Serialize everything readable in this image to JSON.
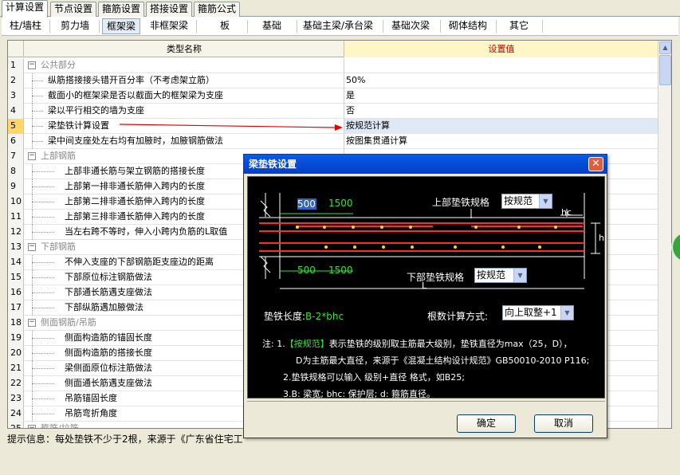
{
  "top_tabs": [
    "计算设置",
    "节点设置",
    "箍筋设置",
    "搭接设置",
    "箍筋公式"
  ],
  "sub_tabs": [
    "柱/墙柱",
    "剪力墙",
    "框架梁",
    "非框架梁",
    "板",
    "基础",
    "基础主梁/承台梁",
    "基础次梁",
    "砌体结构",
    "其它"
  ],
  "grid": {
    "col_name": "类型名称",
    "col_value": "设置值",
    "rows": [
      {
        "num": "1",
        "name": "公共部分",
        "value": ""
      },
      {
        "num": "2",
        "name": "纵筋搭接接头错开百分率（不考虑架立筋）",
        "value": "50%"
      },
      {
        "num": "3",
        "name": "截面小的框架梁是否以截面大的框架梁为支座",
        "value": "是"
      },
      {
        "num": "4",
        "name": "梁以平行相交的墙为支座",
        "value": "否"
      },
      {
        "num": "5",
        "name": "梁垫铁计算设置",
        "value": "按规范计算"
      },
      {
        "num": "6",
        "name": "梁中间支座处左右均有加腋时，加腋钢筋做法",
        "value": "按图集贯通计算"
      },
      {
        "num": "7",
        "name": "上部钢筋",
        "value": ""
      },
      {
        "num": "8",
        "name": "上部非通长筋与架立钢筋的搭接长度",
        "value": ""
      },
      {
        "num": "9",
        "name": "上部第一排非通长筋伸入跨内的长度",
        "value": ""
      },
      {
        "num": "10",
        "name": "上部第二排非通长筋伸入跨内的长度",
        "value": ""
      },
      {
        "num": "11",
        "name": "上部第三排非通长筋伸入跨内的长度",
        "value": ""
      },
      {
        "num": "12",
        "name": "当左右跨不等时，伸入小跨内负筋的L取值",
        "value": ""
      },
      {
        "num": "13",
        "name": "下部钢筋",
        "value": ""
      },
      {
        "num": "14",
        "name": "不伸入支座的下部钢筋距支座边的距离",
        "value": ""
      },
      {
        "num": "15",
        "name": "下部原位标注钢筋做法",
        "value": ""
      },
      {
        "num": "16",
        "name": "下部通长筋遇支座做法",
        "value": ""
      },
      {
        "num": "17",
        "name": "下部纵筋遇加腋做法",
        "value": ""
      },
      {
        "num": "18",
        "name": "侧面钢筋/吊筋",
        "value": ""
      },
      {
        "num": "19",
        "name": "侧面构造筋的锚固长度",
        "value": ""
      },
      {
        "num": "20",
        "name": "侧面构造筋的搭接长度",
        "value": ""
      },
      {
        "num": "21",
        "name": "梁侧面原位标注筋做法",
        "value": ""
      },
      {
        "num": "22",
        "name": "侧面通长筋遇支座做法",
        "value": ""
      },
      {
        "num": "23",
        "name": "吊筋锚固长度",
        "value": ""
      },
      {
        "num": "24",
        "name": "吊筋弯折角度",
        "value": ""
      },
      {
        "num": "25",
        "name": "箍筋/拉筋",
        "value": ""
      }
    ]
  },
  "hint": "提示信息：每处垫铁不少于2根，来源于《广东省住宅工",
  "dialog": {
    "title": "梁垫铁设置",
    "close": "✕",
    "top_spec_label": "上部垫铁规格",
    "top_spec_value": "按规范",
    "bottom_spec_label": "下部垫铁规格",
    "bottom_spec_value": "按规范",
    "dim_500_top": "500",
    "dim_1500_top": "1500",
    "dim_500_bottom": "500",
    "dim_1500_bottom": "1500",
    "dim_hc": "hc",
    "dim_L": "L",
    "dim_h": "h",
    "length_label": "垫铁长度:",
    "length_formula": "B-2*bhc",
    "count_label": "根数计算方式:",
    "count_value": "向上取整+1",
    "note1_prefix": "注: 1.",
    "note1_hl": "【按规范】",
    "note1_rest": "表示垫铁的级别取主筋最大级别，垫铁直径为max（25，D），",
    "note1b": "D为主筋最大直径，来源于《混凝土结构设计规范》GB50010-2010 P116;",
    "note2": "2.垫铁规格可以输入 级别+直径 格式，如B25;",
    "note3": "3.B: 梁宽; bhc: 保护层; d: 箍筋直径。",
    "ok": "确定",
    "cancel": "取消"
  },
  "colors": {
    "accent_blue": "#0548d3",
    "value_header": "#c00000",
    "selected_num": "#ffd76a",
    "rebar_red": "#ff2a2a",
    "rebar_green": "#2ee82e"
  }
}
